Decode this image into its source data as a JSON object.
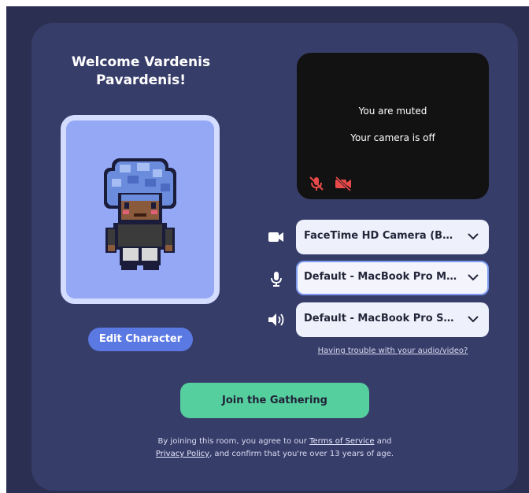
{
  "welcome": {
    "line1": "Welcome Vardenis",
    "line2": "Pavardenis!"
  },
  "avatar": {
    "icon": "pixel-character-avatar",
    "background_color": "#94a8f6"
  },
  "edit_character_label": "Edit Character",
  "preview": {
    "muted_text": "You are muted",
    "camera_off_text": "Your camera is off",
    "status_icons": [
      "mic-off-icon",
      "camera-off-icon"
    ],
    "status_icon_color": "#e84a4a"
  },
  "devices": {
    "camera": {
      "icon": "video-camera-icon",
      "selected": "FaceTime HD Camera (Built-in)"
    },
    "microphone": {
      "icon": "microphone-icon",
      "selected": "Default - MacBook Pro Microphone"
    },
    "speaker": {
      "icon": "speaker-icon",
      "selected": "Default - MacBook Pro Speakers"
    }
  },
  "trouble_link": "Having trouble with your audio/video?",
  "join_label": "Join the Gathering",
  "legal": {
    "part1": "By joining this room, you agree to our",
    "terms": "Terms of Service",
    "part2": "and",
    "privacy": "Privacy Policy",
    "part3": ", and confirm that you're over 13 years of age."
  },
  "colors": {
    "backdrop": "#2b2f52",
    "card": "#373d69",
    "accent_blue": "#5b79e3",
    "join_green": "#56cf9e"
  }
}
